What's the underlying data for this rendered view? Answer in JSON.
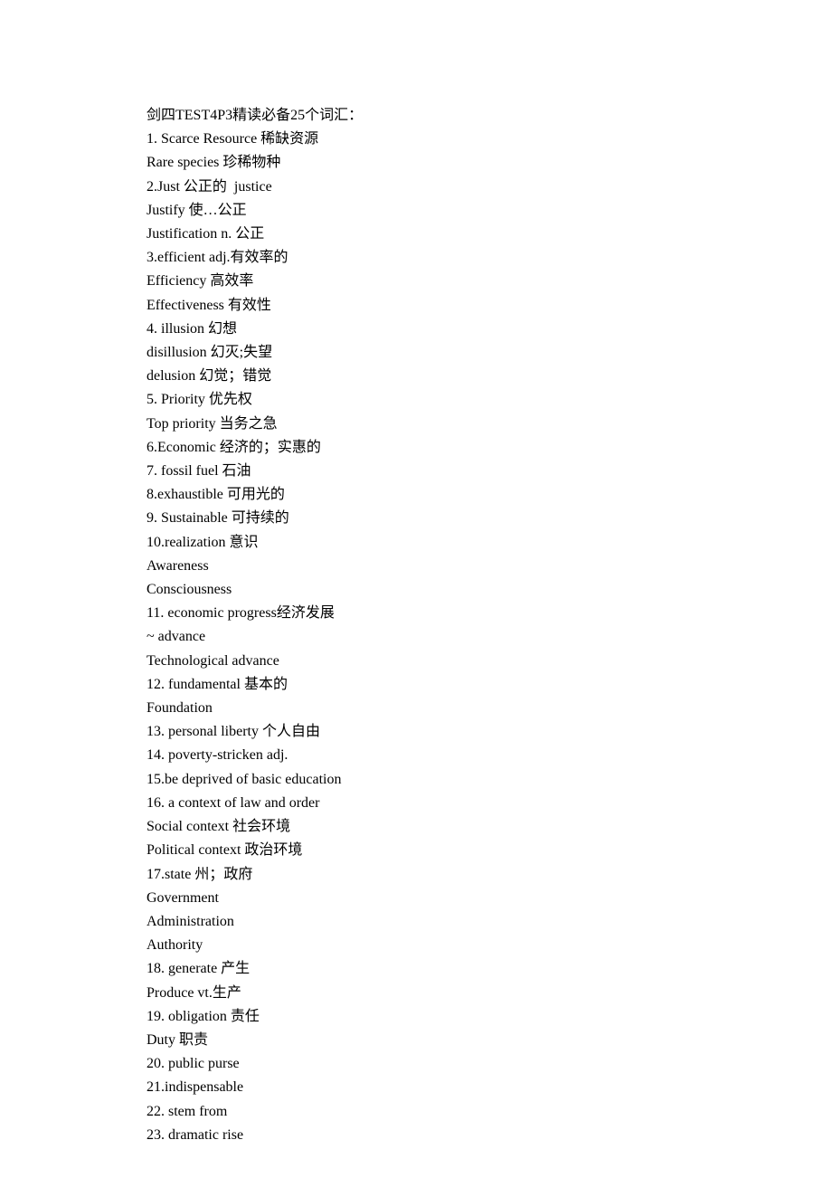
{
  "lines": [
    "剑四TEST4P3精读必备25个词汇：",
    "1. Scarce Resource 稀缺资源",
    "Rare species 珍稀物种",
    "2.Just 公正的  justice",
    "Justify 使…公正",
    "Justification n. 公正",
    "3.efficient adj.有效率的",
    "Efficiency 高效率",
    "Effectiveness 有效性",
    "4. illusion 幻想",
    "disillusion 幻灭;失望",
    "delusion 幻觉；错觉",
    "5. Priority 优先权",
    "Top priority 当务之急",
    "6.Economic 经济的；实惠的",
    "7. fossil fuel 石油",
    "8.exhaustible 可用光的",
    "9. Sustainable 可持续的",
    "10.realization 意识",
    "Awareness",
    "Consciousness",
    "11. economic progress经济发展",
    "~ advance",
    "Technological advance",
    "12. fundamental 基本的",
    "Foundation",
    "13. personal liberty 个人自由",
    "14. poverty-stricken adj.",
    "15.be deprived of basic education",
    "16. a context of law and order",
    "Social context 社会环境",
    "Political context 政治环境",
    "17.state 州；政府",
    "Government",
    "Administration",
    "Authority",
    "18. generate 产生",
    "Produce vt.生产",
    "19. obligation 责任",
    "Duty 职责",
    "20. public purse",
    "21.indispensable",
    "22. stem from",
    "23. dramatic rise"
  ]
}
